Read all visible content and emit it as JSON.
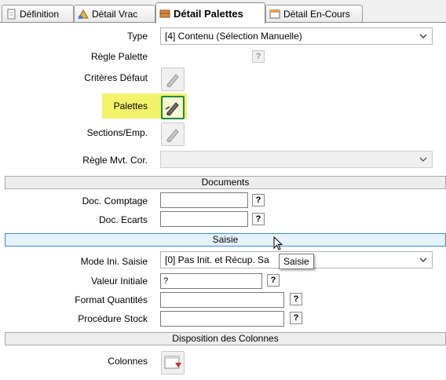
{
  "tabs": [
    {
      "label": "Définition",
      "icon": "page-icon"
    },
    {
      "label": "Détail Vrac",
      "icon": "bulk-icon"
    },
    {
      "label": "Détail Palettes",
      "icon": "pallet-icon"
    },
    {
      "label": "Détail En-Cours",
      "icon": "window-icon"
    }
  ],
  "form": {
    "type": {
      "label": "Type",
      "value": "[4] Contenu (Sélection Manuelle)"
    },
    "regle_palette": {
      "label": "Règle Palette",
      "button": "?"
    },
    "criteres_defaut": {
      "label": "Critères Défaut"
    },
    "palettes": {
      "label": "Palettes"
    },
    "sections_emp": {
      "label": "Sections/Emp."
    },
    "regle_mvt_cor": {
      "label": "Règle Mvt. Cor.",
      "value": ""
    }
  },
  "documents": {
    "header": "Documents",
    "doc_comptage": {
      "label": "Doc. Comptagе",
      "value": "",
      "button": "?"
    },
    "doc_ecarts": {
      "label": "Doc. Ecarts",
      "value": "",
      "button": "?"
    }
  },
  "saisie": {
    "header": "Saisie",
    "mode_ini": {
      "label": "Mode Ini. Saisie",
      "value": "[0] Pas Init. et Récup. Sa"
    },
    "valeur_initiale": {
      "label": "Valeur Initiale",
      "value": "?",
      "button": "?"
    },
    "format_quantites": {
      "label": "Format Quantités",
      "value": "",
      "button": "?"
    },
    "procedure_stock": {
      "label": "Procédure Stock",
      "value": "",
      "button": "?"
    }
  },
  "colonnes": {
    "header": "Disposition des Colonnes",
    "label": "Colonnes"
  },
  "tooltip": "Saisie",
  "colors": {
    "highlight": "#f3f36b",
    "section_hover": "#e5f1fb",
    "section_border": "#3c8ad6",
    "palettes_icon_border": "#1e8a3a"
  }
}
